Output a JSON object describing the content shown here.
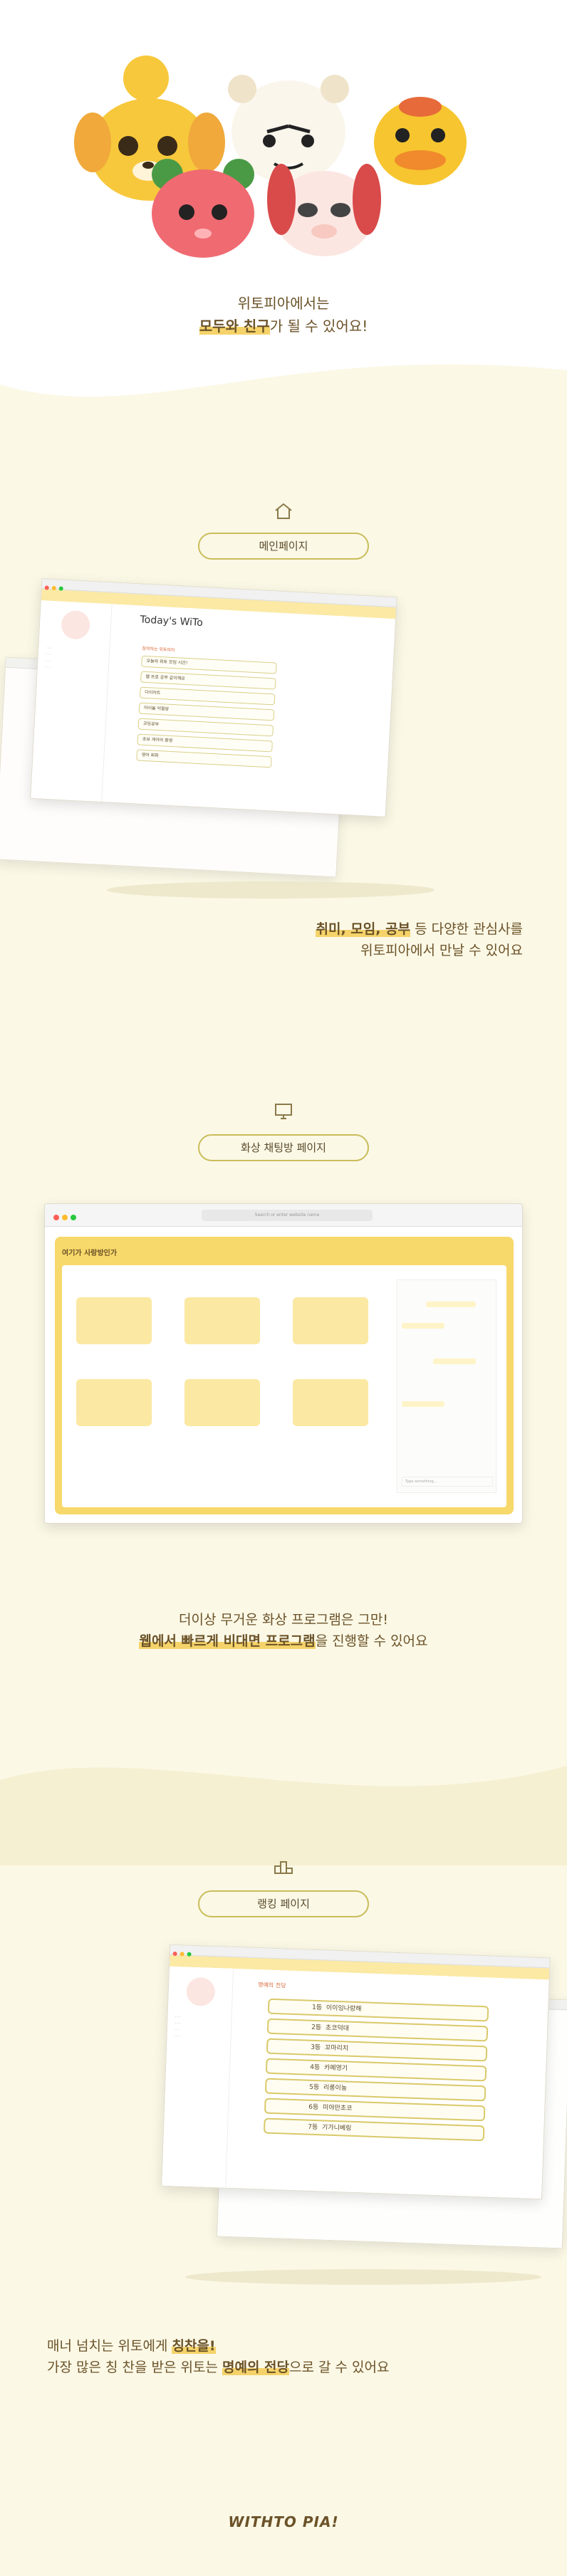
{
  "hero": {
    "line1": "위토피아에서는",
    "line2_hl": "모두와 친구",
    "line2_rest": "가 될 수 있어요!"
  },
  "sections": {
    "main": {
      "pill_label": "메인페이지",
      "icon": "home-icon",
      "browser_title": "Today's WiTo",
      "list_title": "참여하는 위토피아",
      "rows": [
        "오늘의 위토 모임 시간!",
        "웹 프로 공부 같이해요",
        "다이어트",
        "아이돌 덕질방",
        "코딩공부",
        "초보 게이머 환영",
        "영어 회화"
      ],
      "caption_line1_hl": "취미, 모임, 공부",
      "caption_line1_rest": " 등 다양한 관심사를",
      "caption_line2": "위토피아에서 만날 수 있어요"
    },
    "video": {
      "pill_label": "화상 채팅방 페이지",
      "icon": "monitor-icon",
      "search_placeholder": "Search or enter website name",
      "room_title": "여기가 사랑방인가",
      "chat_placeholder": "Type something...",
      "caption_line1": "더이상 무거운 화상 프로그램은 그만!",
      "caption_line2_hl": "웹에서 빠르게 비대면 프로그램",
      "caption_line2_rest": "을 진행할 수 있어요"
    },
    "ranking": {
      "pill_label": "랭킹 페이지",
      "icon": "podium-icon",
      "title": "명예의 전당",
      "rows": [
        {
          "rank": "1등",
          "name": "이이잉나랑해"
        },
        {
          "rank": "2등",
          "name": "초코덕대"
        },
        {
          "rank": "3등",
          "name": "꼬마리치"
        },
        {
          "rank": "4등",
          "name": "카페영기"
        },
        {
          "rank": "5등",
          "name": "리롱이농"
        },
        {
          "rank": "6등",
          "name": "미야만초코"
        },
        {
          "rank": "7등",
          "name": "기가니베링"
        }
      ],
      "caption_line1_pre": "매너 넘치는 위토에게 ",
      "caption_line1_hl": "칭찬을!",
      "caption_line2_pre": "가장 많은 칭 찬을 받은 위토는 ",
      "caption_line2_hl": "명예의 전당",
      "caption_line2_rest": "으로 갈 수 있어요"
    }
  },
  "footer": {
    "logo": "WITHTO PIA!"
  },
  "colors": {
    "accent": "#f5d36a",
    "bg": "#fbf8e6",
    "text": "#6b5228"
  }
}
